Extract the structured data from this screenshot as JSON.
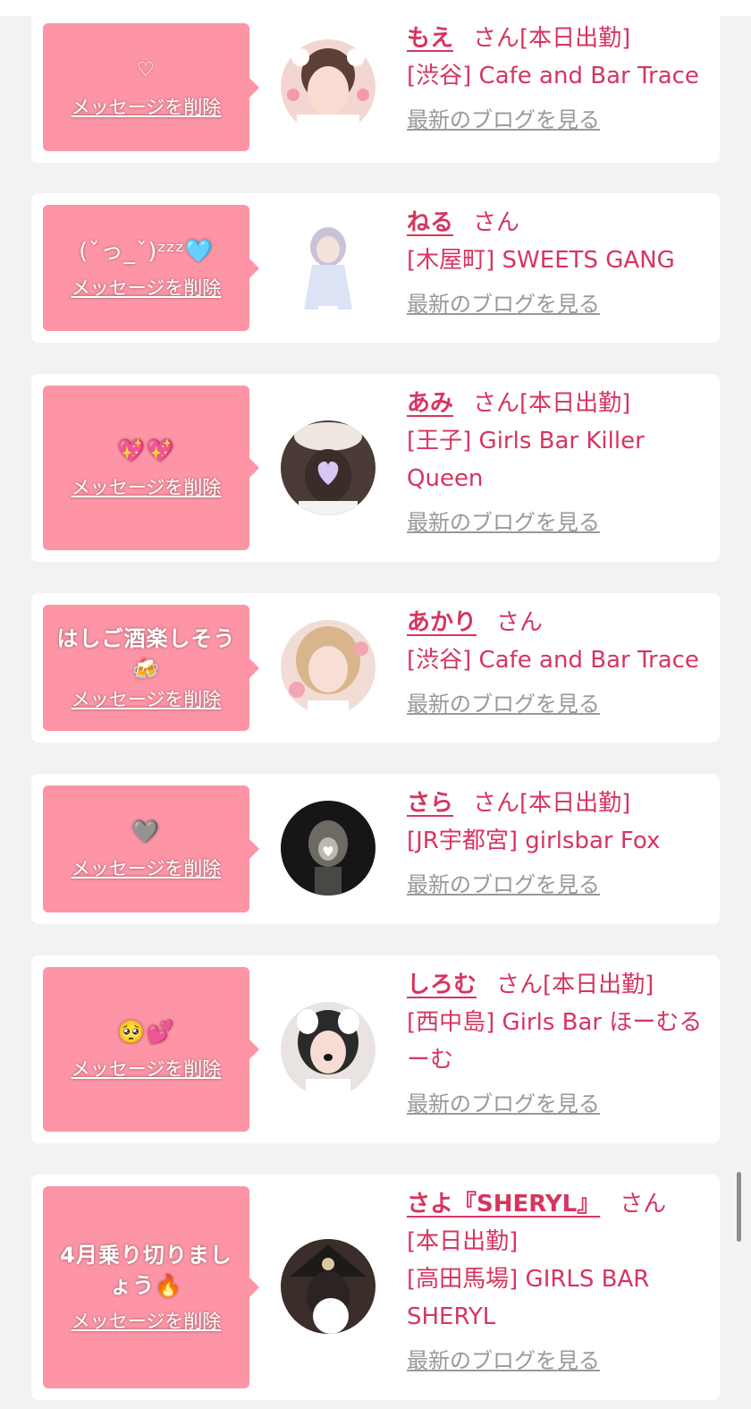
{
  "delete_label": "メッセージを削除",
  "san_label": "さん",
  "blog_label": "最新のブログを見る",
  "accent_color": "#d6355f",
  "bubble_color": "#fd95a6",
  "cards": [
    {
      "message": "♡",
      "name": "もえ",
      "status": "[本日出勤]",
      "shop": "[渋谷] Cafe and Bar Trace"
    },
    {
      "message": "(ˇっ_ˇ)ᶻᶻᶻ🩵",
      "name": "ねる",
      "status": "",
      "shop": "[木屋町] SWEETS GANG"
    },
    {
      "message": "💖💖",
      "name": "あみ",
      "status": "[本日出勤]",
      "shop": "[王子] Girls Bar Killer Queen"
    },
    {
      "message": "はしご酒楽しそう🍻",
      "name": "あかり",
      "status": "",
      "shop": "[渋谷] Cafe and Bar Trace"
    },
    {
      "message": "🩶",
      "name": "さら",
      "status": "[本日出勤]",
      "shop": "[JR宇都宮] girlsbar Fox"
    },
    {
      "message": "🥺💕",
      "name": "しろむ",
      "status": "[本日出勤]",
      "shop": "[西中島] Girls Bar ほーむるーむ"
    },
    {
      "message": "4月乗り切りましょう🔥",
      "name": "さよ『SHERYL』",
      "status": "[本日出勤]",
      "shop": "[高田馬場] GIRLS BAR SHERYL"
    }
  ]
}
